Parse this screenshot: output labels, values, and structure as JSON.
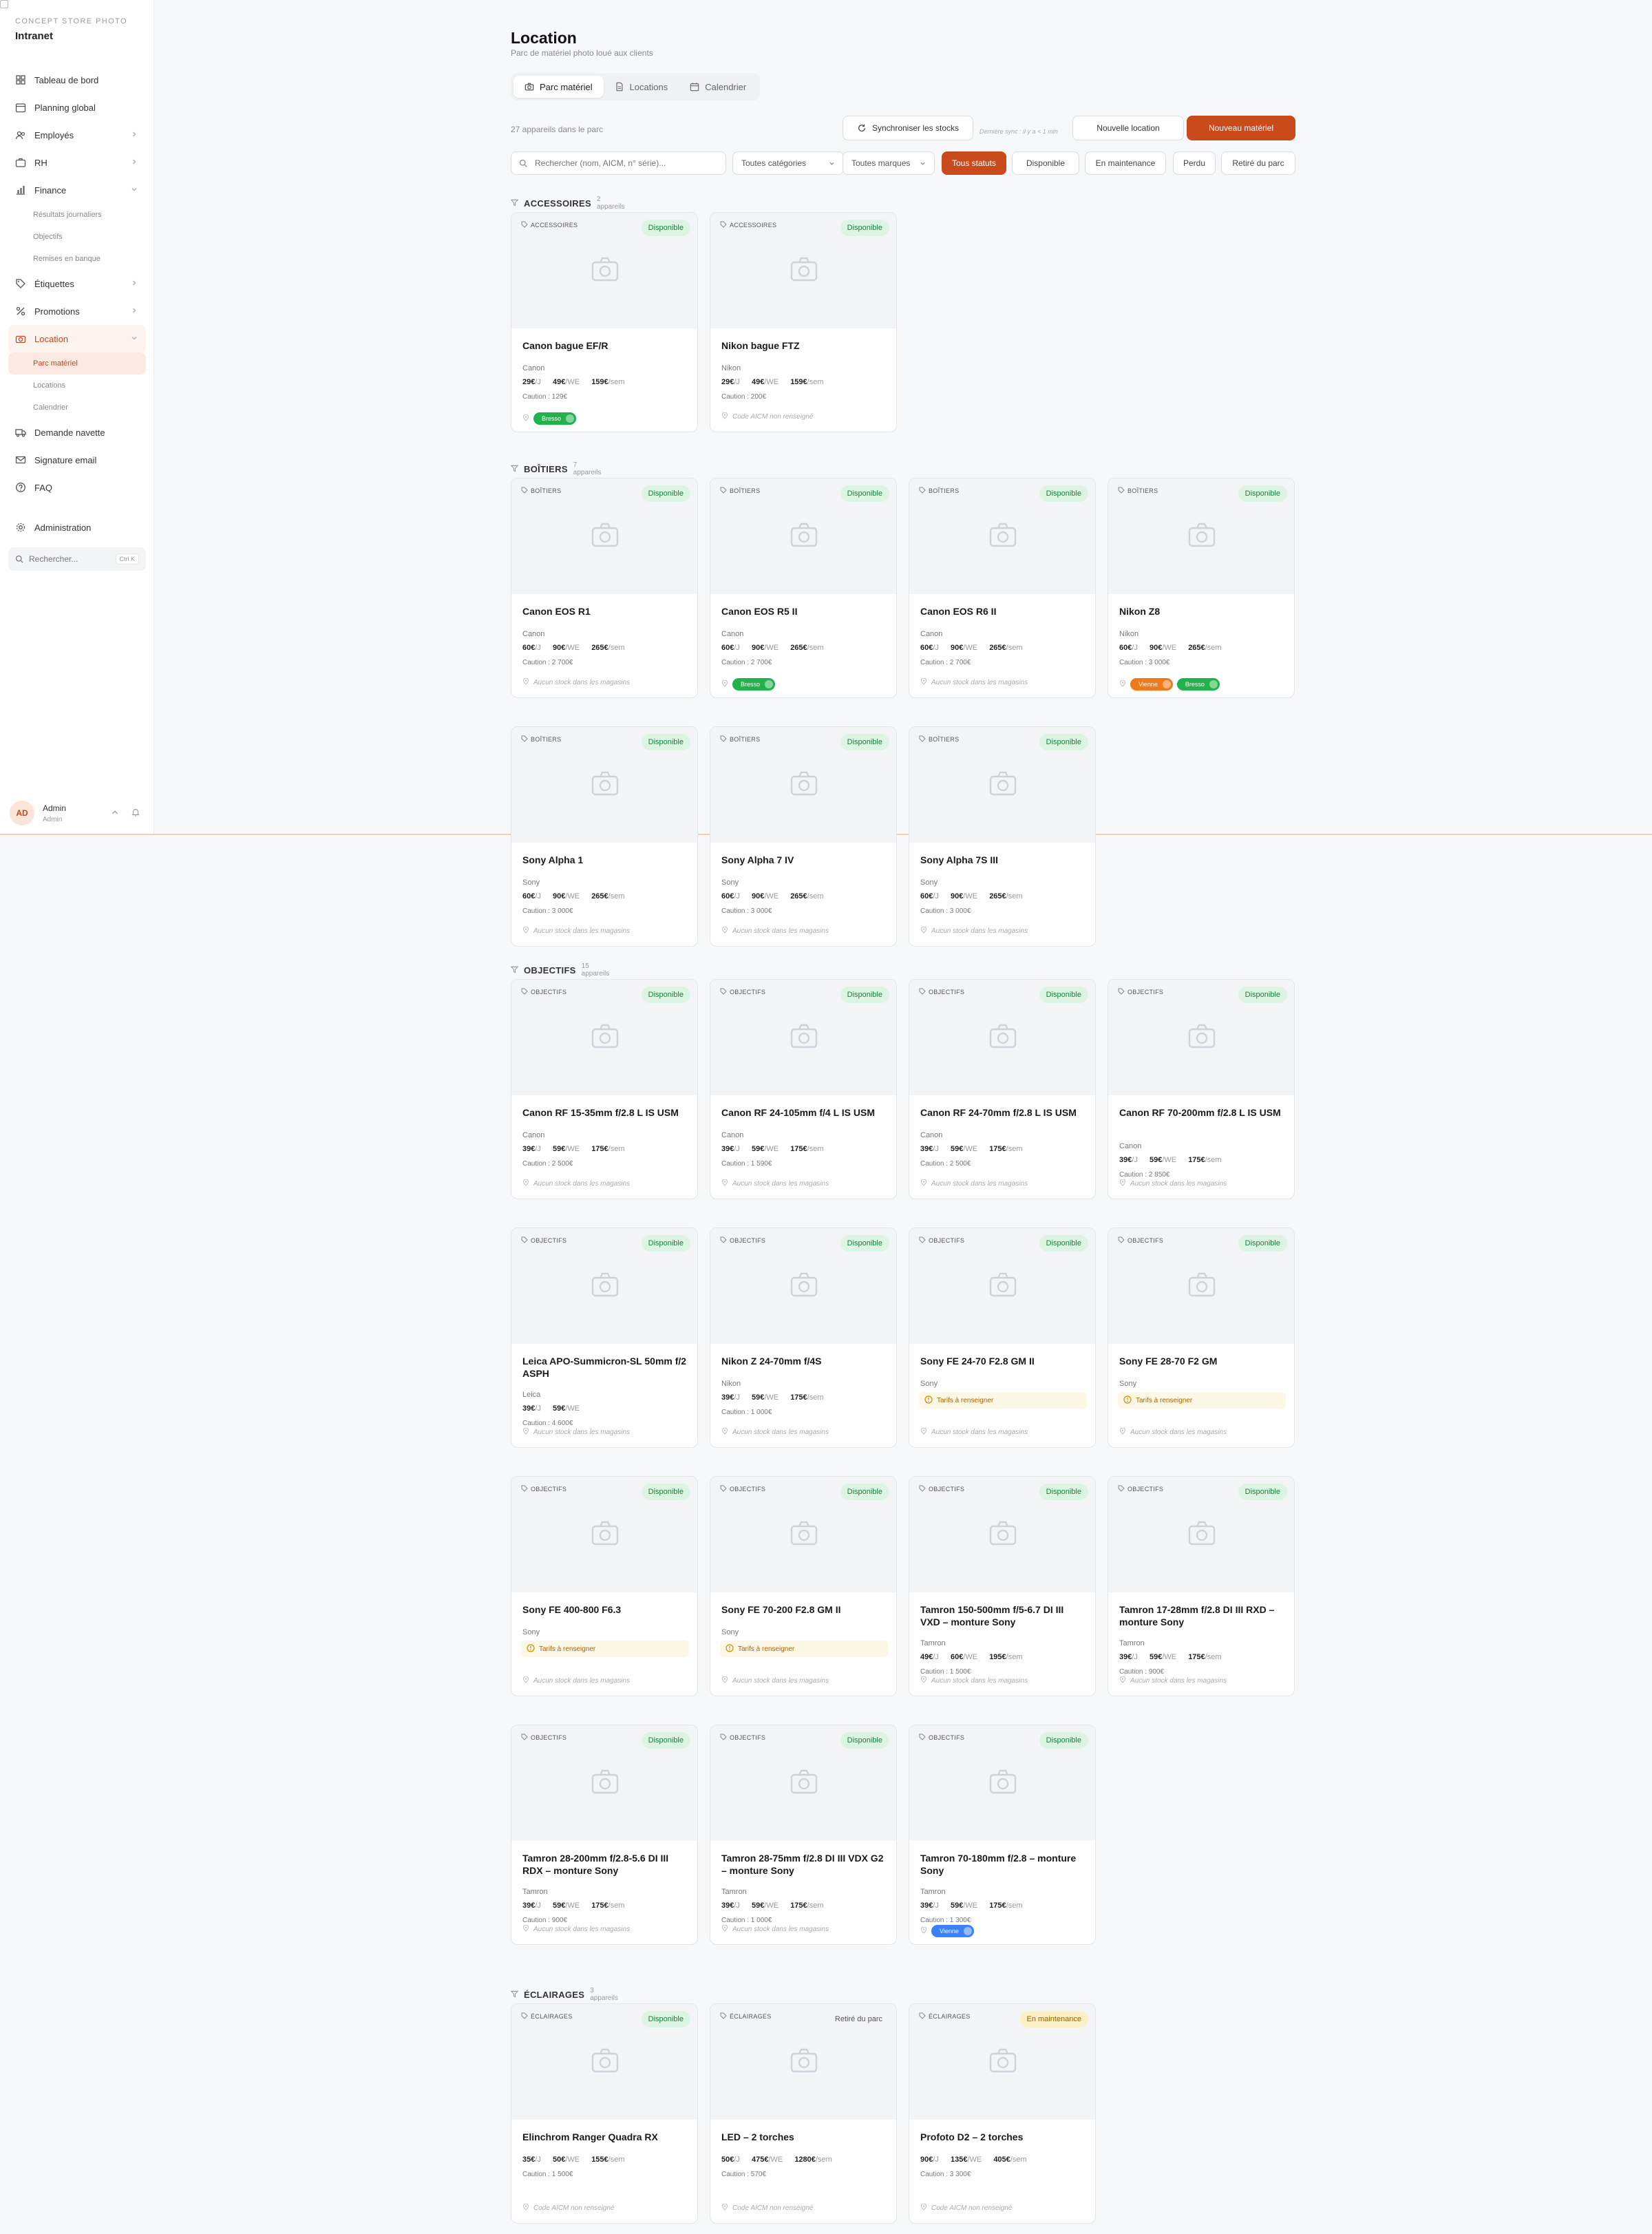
{
  "sidebar": {
    "brand_sub": "CONCEPT STORE PHOTO",
    "brand_name": "Intranet",
    "items": [
      {
        "label": "Tableau de bord",
        "icon": "dashboard-icon"
      },
      {
        "label": "Planning global",
        "icon": "calendar-icon"
      },
      {
        "label": "Employés",
        "icon": "users-icon",
        "chevron": "right"
      },
      {
        "label": "RH",
        "icon": "briefcase-icon",
        "chevron": "right"
      },
      {
        "label": "Finance",
        "icon": "chart-icon",
        "chevron": "down"
      }
    ],
    "finance_sub": [
      "Résultats journaliers",
      "Objectifs",
      "Remises en banque"
    ],
    "items2": [
      {
        "label": "Étiquettes",
        "icon": "tag-icon",
        "chevron": "right"
      },
      {
        "label": "Promotions",
        "icon": "percent-icon",
        "chevron": "right"
      },
      {
        "label": "Location",
        "icon": "camera-icon",
        "chevron": "down"
      }
    ],
    "location_sub": [
      "Parc matériel",
      "Locations",
      "Calendrier"
    ],
    "items3": [
      {
        "label": "Demande navette",
        "icon": "truck-icon"
      },
      {
        "label": "Signature email",
        "icon": "mail-icon"
      },
      {
        "label": "FAQ",
        "icon": "help-icon"
      }
    ],
    "admin_label": "Administration",
    "search_placeholder": "Rechercher...",
    "search_kbd": "Ctrl K",
    "user": {
      "initials": "AD",
      "name": "Admin",
      "role": "Admin"
    }
  },
  "header": {
    "title": "Location",
    "subtitle": "Parc de matériel photo loué aux clients",
    "tabs": [
      "Parc matériel",
      "Locations",
      "Calendrier"
    ]
  },
  "toolbar": {
    "count": "27 appareils dans le parc",
    "sync_label": "Synchroniser les stocks",
    "sync_note": "Dernière sync : il y a < 1 min",
    "new_rental": "Nouvelle location",
    "new_equipment": "Nouveau matériel"
  },
  "filters": {
    "search_placeholder": "Rechercher (nom, AICM, n° série)...",
    "category": "Toutes catégories",
    "brand": "Toutes marques",
    "statuses": [
      "Tous statuts",
      "Disponible",
      "En maintenance",
      "Perdu",
      "Retiré du parc"
    ]
  },
  "sections": [
    {
      "name": "ACCESSOIRES",
      "count": "2 appareils",
      "cards": [
        {
          "cat": "ACCESSOIRES",
          "status": "Disponible",
          "title": "Canon bague EF/R",
          "brand": "Canon",
          "p1": "29€",
          "u1": "/J",
          "p2": "49€",
          "u2": "/WE",
          "p3": "159€",
          "u3": "/sem",
          "deposit": "Caution : 129€",
          "pills": [
            {
              "t": "Bresso",
              "c": "green"
            }
          ]
        },
        {
          "cat": "ACCESSOIRES",
          "status": "Disponible",
          "title": "Nikon bague FTZ",
          "brand": "Nikon",
          "p1": "29€",
          "u1": "/J",
          "p2": "49€",
          "u2": "/WE",
          "p3": "159€",
          "u3": "/sem",
          "deposit": "Caution : 200€",
          "foot": "Code AICM non renseigné"
        }
      ]
    },
    {
      "name": "BOÎTIERS",
      "count": "7 appareils",
      "cards": [
        {
          "cat": "BOÎTIERS",
          "status": "Disponible",
          "title": "Canon EOS R1",
          "brand": "Canon",
          "p1": "60€",
          "u1": "/J",
          "p2": "90€",
          "u2": "/WE",
          "p3": "265€",
          "u3": "/sem",
          "deposit": "Caution : 2 700€",
          "foot": "Aucun stock dans les magasins"
        },
        {
          "cat": "BOÎTIERS",
          "status": "Disponible",
          "title": "Canon EOS R5 II",
          "brand": "Canon",
          "p1": "60€",
          "u1": "/J",
          "p2": "90€",
          "u2": "/WE",
          "p3": "265€",
          "u3": "/sem",
          "deposit": "Caution : 2 700€",
          "pills": [
            {
              "t": "Bresso",
              "c": "green"
            }
          ]
        },
        {
          "cat": "BOÎTIERS",
          "status": "Disponible",
          "title": "Canon EOS R6 II",
          "brand": "Canon",
          "p1": "60€",
          "u1": "/J",
          "p2": "90€",
          "u2": "/WE",
          "p3": "265€",
          "u3": "/sem",
          "deposit": "Caution : 2 700€",
          "foot": "Aucun stock dans les magasins"
        },
        {
          "cat": "BOÎTIERS",
          "status": "Disponible",
          "title": "Nikon Z8",
          "brand": "Nikon",
          "p1": "60€",
          "u1": "/J",
          "p2": "90€",
          "u2": "/WE",
          "p3": "265€",
          "u3": "/sem",
          "deposit": "Caution : 3 000€",
          "pills": [
            {
              "t": "Vienne",
              "c": "orange"
            },
            {
              "t": "Bresso",
              "c": "green"
            }
          ]
        },
        {
          "cat": "BOÎTIERS",
          "status": "Disponible",
          "title": "Sony Alpha 1",
          "brand": "Sony",
          "p1": "60€",
          "u1": "/J",
          "p2": "90€",
          "u2": "/WE",
          "p3": "265€",
          "u3": "/sem",
          "deposit": "Caution : 3 000€",
          "foot": "Aucun stock dans les magasins"
        },
        {
          "cat": "BOÎTIERS",
          "status": "Disponible",
          "title": "Sony Alpha 7 IV",
          "brand": "Sony",
          "p1": "60€",
          "u1": "/J",
          "p2": "90€",
          "u2": "/WE",
          "p3": "265€",
          "u3": "/sem",
          "deposit": "Caution : 3 000€",
          "foot": "Aucun stock dans les magasins"
        },
        {
          "cat": "BOÎTIERS",
          "status": "Disponible",
          "title": "Sony Alpha 7S III",
          "brand": "Sony",
          "p1": "60€",
          "u1": "/J",
          "p2": "90€",
          "u2": "/WE",
          "p3": "265€",
          "u3": "/sem",
          "deposit": "Caution : 3 000€",
          "foot": "Aucun stock dans les magasins"
        }
      ]
    },
    {
      "name": "OBJECTIFS",
      "count": "15 appareils",
      "cards": [
        {
          "cat": "OBJECTIFS",
          "status": "Disponible",
          "title": "Canon RF 15-35mm f/2.8 L IS USM",
          "brand": "Canon",
          "p1": "39€",
          "u1": "/J",
          "p2": "59€",
          "u2": "/WE",
          "p3": "175€",
          "u3": "/sem",
          "deposit": "Caution : 2 500€",
          "foot": "Aucun stock dans les magasins"
        },
        {
          "cat": "OBJECTIFS",
          "status": "Disponible",
          "title": "Canon RF 24-105mm f/4 L IS USM",
          "brand": "Canon",
          "p1": "39€",
          "u1": "/J",
          "p2": "59€",
          "u2": "/WE",
          "p3": "175€",
          "u3": "/sem",
          "deposit": "Caution : 1 590€",
          "foot": "Aucun stock dans les magasins"
        },
        {
          "cat": "OBJECTIFS",
          "status": "Disponible",
          "title": "Canon RF 24-70mm f/2.8 L IS USM",
          "brand": "Canon",
          "p1": "39€",
          "u1": "/J",
          "p2": "59€",
          "u2": "/WE",
          "p3": "175€",
          "u3": "/sem",
          "deposit": "Caution : 2 500€",
          "foot": "Aucun stock dans les magasins"
        },
        {
          "cat": "OBJECTIFS",
          "status": "Disponible",
          "title": "Canon RF 70-200mm f/2.8 L IS USM",
          "two": true,
          "brand": "Canon",
          "p1": "39€",
          "u1": "/J",
          "p2": "59€",
          "u2": "/WE",
          "p3": "175€",
          "u3": "/sem",
          "deposit": "Caution : 2 850€",
          "foot": "Aucun stock dans les magasins"
        },
        {
          "cat": "OBJECTIFS",
          "status": "Disponible",
          "title": "Leica APO-Summicron-SL 50mm f/2 ASPH",
          "two": true,
          "brand": "Leica",
          "p1": "39€",
          "u1": "/J",
          "p2": "59€",
          "u2": "/WE",
          "deposit": "Caution : 4 600€",
          "foot": "Aucun stock dans les magasins"
        },
        {
          "cat": "OBJECTIFS",
          "status": "Disponible",
          "title": "Nikon Z 24-70mm f/4S",
          "brand": "Nikon",
          "p1": "39€",
          "u1": "/J",
          "p2": "59€",
          "u2": "/WE",
          "p3": "175€",
          "u3": "/sem",
          "deposit": "Caution : 1 000€",
          "foot": "Aucun stock dans les magasins"
        },
        {
          "cat": "OBJECTIFS",
          "status": "Disponible",
          "title": "Sony FE 24-70 F2.8 GM II",
          "brand": "Sony",
          "warn": "Tarifs à renseigner",
          "foot": "Aucun stock dans les magasins"
        },
        {
          "cat": "OBJECTIFS",
          "status": "Disponible",
          "title": "Sony FE 28-70 F2 GM",
          "brand": "Sony",
          "warn": "Tarifs à renseigner",
          "foot": "Aucun stock dans les magasins"
        },
        {
          "cat": "OBJECTIFS",
          "status": "Disponible",
          "title": "Sony FE 400-800 F6.3",
          "brand": "Sony",
          "warn": "Tarifs à renseigner",
          "foot": "Aucun stock dans les magasins"
        },
        {
          "cat": "OBJECTIFS",
          "status": "Disponible",
          "title": "Sony FE 70-200 F2.8 GM II",
          "brand": "Sony",
          "warn": "Tarifs à renseigner",
          "foot": "Aucun stock dans les magasins"
        },
        {
          "cat": "OBJECTIFS",
          "status": "Disponible",
          "title": "Tamron 150-500mm f/5-6.7 DI III VXD – monture Sony",
          "two": true,
          "brand": "Tamron",
          "p1": "49€",
          "u1": "/J",
          "p2": "60€",
          "u2": "/WE",
          "p3": "195€",
          "u3": "/sem",
          "deposit": "Caution : 1 500€",
          "foot": "Aucun stock dans les magasins"
        },
        {
          "cat": "OBJECTIFS",
          "status": "Disponible",
          "title": "Tamron 17-28mm f/2.8 DI III RXD – monture Sony",
          "two": true,
          "brand": "Tamron",
          "p1": "39€",
          "u1": "/J",
          "p2": "59€",
          "u2": "/WE",
          "p3": "175€",
          "u3": "/sem",
          "deposit": "Caution : 900€",
          "foot": "Aucun stock dans les magasins"
        },
        {
          "cat": "OBJECTIFS",
          "status": "Disponible",
          "title": "Tamron 28-200mm f/2.8-5.6 DI III RDX – monture Sony",
          "two": true,
          "brand": "Tamron",
          "p1": "39€",
          "u1": "/J",
          "p2": "59€",
          "u2": "/WE",
          "p3": "175€",
          "u3": "/sem",
          "deposit": "Caution : 900€",
          "foot": "Aucun stock dans les magasins"
        },
        {
          "cat": "OBJECTIFS",
          "status": "Disponible",
          "title": "Tamron 28-75mm f/2.8 DI III VDX G2 – monture Sony",
          "two": true,
          "brand": "Tamron",
          "p1": "39€",
          "u1": "/J",
          "p2": "59€",
          "u2": "/WE",
          "p3": "175€",
          "u3": "/sem",
          "deposit": "Caution : 1 000€",
          "foot": "Aucun stock dans les magasins"
        },
        {
          "cat": "OBJECTIFS",
          "status": "Disponible",
          "title": "Tamron 70-180mm f/2.8 – monture Sony",
          "two": true,
          "brand": "Tamron",
          "p1": "39€",
          "u1": "/J",
          "p2": "59€",
          "u2": "/WE",
          "p3": "175€",
          "u3": "/sem",
          "deposit": "Caution : 1 300€",
          "pills": [
            {
              "t": "Vienne",
              "c": "blue"
            }
          ]
        }
      ]
    },
    {
      "name": "ÉCLAIRAGES",
      "count": "3 appareils",
      "cards": [
        {
          "cat": "ÉCLAIRAGES",
          "status": "Disponible",
          "status_kind": "ok",
          "title": "Elinchrom Ranger Quadra RX",
          "brand": "",
          "p1": "35€",
          "u1": "/J",
          "p2": "50€",
          "u2": "/WE",
          "p3": "155€",
          "u3": "/sem",
          "deposit": "Caution : 1 500€",
          "foot": "Code AICM non renseigné"
        },
        {
          "cat": "ÉCLAIRAGES",
          "status": "Retiré du parc",
          "status_kind": "retired",
          "title": "LED – 2 torches",
          "brand": "",
          "p1": "50€",
          "u1": "/J",
          "p2": "475€",
          "u2": "/WE",
          "p3": "1280€",
          "u3": "/sem",
          "deposit": "Caution : 570€",
          "foot": "Code AICM non renseigné"
        },
        {
          "cat": "ÉCLAIRAGES",
          "status": "En maintenance",
          "status_kind": "maint",
          "title": "Profoto D2 – 2 torches",
          "brand": "",
          "p1": "90€",
          "u1": "/J",
          "p2": "135€",
          "u2": "/WE",
          "p3": "405€",
          "u3": "/sem",
          "deposit": "Caution : 3 300€",
          "foot": "Code AICM non renseigné"
        }
      ]
    }
  ]
}
